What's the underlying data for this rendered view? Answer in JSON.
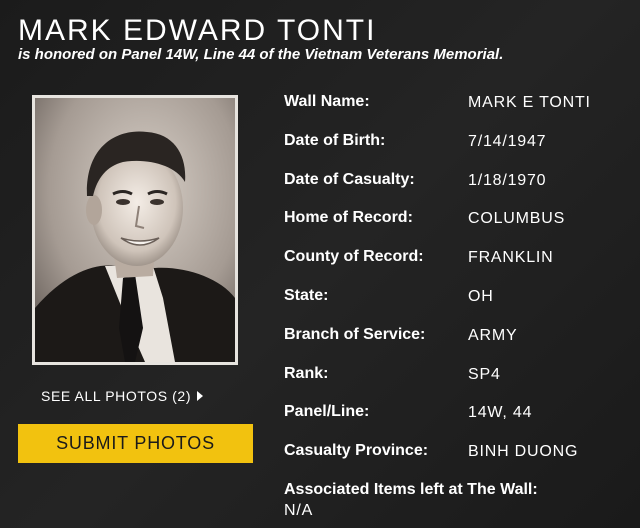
{
  "header": {
    "name": "MARK EDWARD TONTI",
    "subtitle": "is honored on Panel 14W, Line 44 of the Vietnam Veterans Memorial."
  },
  "photo": {
    "see_all_label": "SEE ALL PHOTOS (2)",
    "submit_label": "SUBMIT PHOTOS"
  },
  "fields": [
    {
      "label": "Wall Name:",
      "value": "MARK E TONTI"
    },
    {
      "label": "Date of Birth:",
      "value": "7/14/1947"
    },
    {
      "label": "Date of Casualty:",
      "value": "1/18/1970"
    },
    {
      "label": "Home of Record:",
      "value": "COLUMBUS"
    },
    {
      "label": "County of Record:",
      "value": "FRANKLIN"
    },
    {
      "label": "State:",
      "value": "OH"
    },
    {
      "label": "Branch of Service:",
      "value": "ARMY"
    },
    {
      "label": "Rank:",
      "value": "SP4"
    },
    {
      "label": "Panel/Line:",
      "value": "14W, 44"
    },
    {
      "label": "Casualty Province:",
      "value": "BINH DUONG"
    }
  ],
  "associated": {
    "label": "Associated Items left at The Wall:",
    "value": "N/A"
  },
  "colors": {
    "background": "#1f1f1f",
    "button": "#f2c20f",
    "text": "#ffffff"
  }
}
